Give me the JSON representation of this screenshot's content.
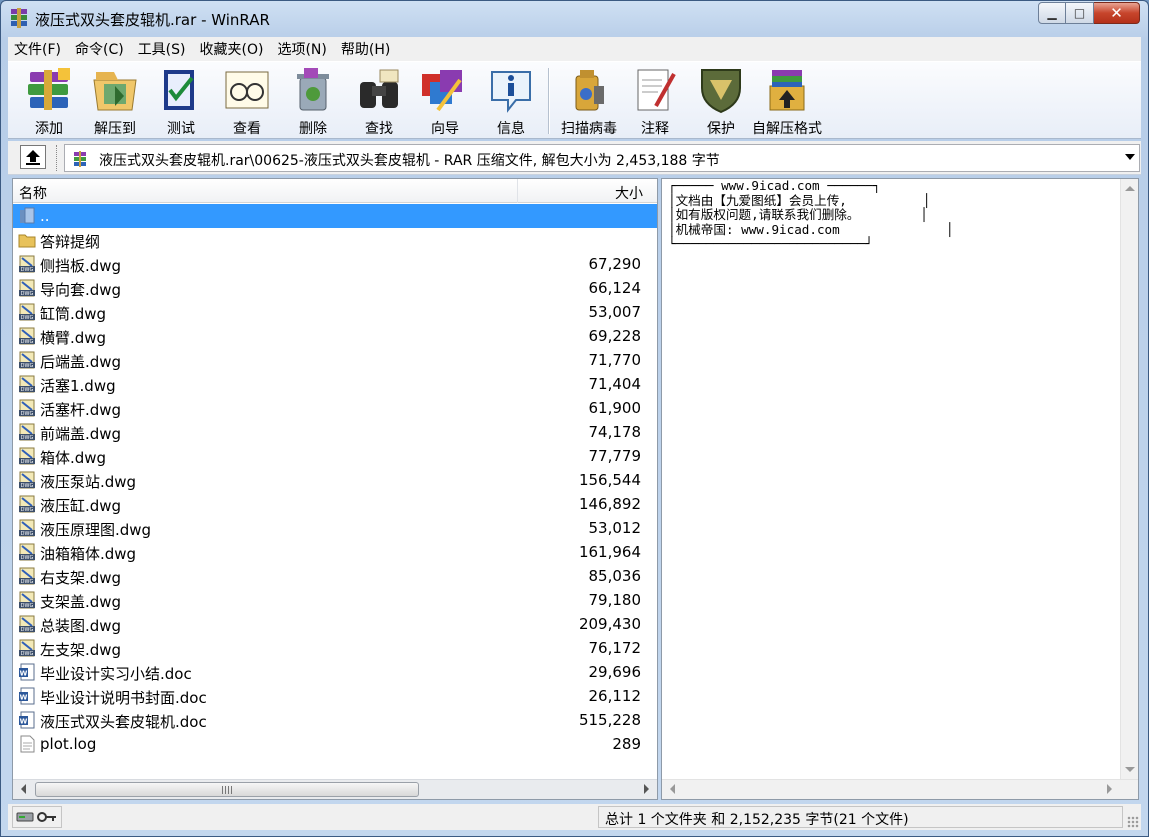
{
  "window": {
    "title": "液压式双头套皮辊机.rar - WinRAR",
    "controls": {
      "minimize": "▁",
      "maximize": "□",
      "close": "✕"
    }
  },
  "menu": [
    "文件(F)",
    "命令(C)",
    "工具(S)",
    "收藏夹(O)",
    "选项(N)",
    "帮助(H)"
  ],
  "toolbar": [
    {
      "label": "添加",
      "icon": "add-books-icon"
    },
    {
      "label": "解压到",
      "icon": "extract-to-icon"
    },
    {
      "label": "测试",
      "icon": "test-icon"
    },
    {
      "label": "查看",
      "icon": "view-icon"
    },
    {
      "label": "删除",
      "icon": "delete-icon"
    },
    {
      "label": "查找",
      "icon": "find-icon"
    },
    {
      "label": "向导",
      "icon": "wizard-icon"
    },
    {
      "label": "信息",
      "icon": "info-icon"
    },
    {
      "label": "扫描病毒",
      "icon": "virus-scan-icon"
    },
    {
      "label": "注释",
      "icon": "comment-icon"
    },
    {
      "label": "保护",
      "icon": "protect-icon"
    },
    {
      "label": "自解压格式",
      "icon": "sfx-icon"
    }
  ],
  "address": {
    "path": "液压式双头套皮辊机.rar\\00625-液压式双头套皮辊机 - RAR 压缩文件, 解包大小为 2,453,188 字节"
  },
  "filelist": {
    "columns": {
      "name": "名称",
      "size": "大小"
    },
    "rows": [
      {
        "name": "..",
        "size": "",
        "type": "up"
      },
      {
        "name": "答辩提纲",
        "size": "",
        "type": "folder"
      },
      {
        "name": "侧挡板.dwg",
        "size": "67,290",
        "type": "dwg"
      },
      {
        "name": "导向套.dwg",
        "size": "66,124",
        "type": "dwg"
      },
      {
        "name": "缸筒.dwg",
        "size": "53,007",
        "type": "dwg"
      },
      {
        "name": "横臂.dwg",
        "size": "69,228",
        "type": "dwg"
      },
      {
        "name": "后端盖.dwg",
        "size": "71,770",
        "type": "dwg"
      },
      {
        "name": "活塞1.dwg",
        "size": "71,404",
        "type": "dwg"
      },
      {
        "name": "活塞杆.dwg",
        "size": "61,900",
        "type": "dwg"
      },
      {
        "name": "前端盖.dwg",
        "size": "74,178",
        "type": "dwg"
      },
      {
        "name": "箱体.dwg",
        "size": "77,779",
        "type": "dwg"
      },
      {
        "name": "液压泵站.dwg",
        "size": "156,544",
        "type": "dwg"
      },
      {
        "name": "液压缸.dwg",
        "size": "146,892",
        "type": "dwg"
      },
      {
        "name": "液压原理图.dwg",
        "size": "53,012",
        "type": "dwg"
      },
      {
        "name": "油箱箱体.dwg",
        "size": "161,964",
        "type": "dwg"
      },
      {
        "name": "右支架.dwg",
        "size": "85,036",
        "type": "dwg"
      },
      {
        "name": "支架盖.dwg",
        "size": "79,180",
        "type": "dwg"
      },
      {
        "name": "总装图.dwg",
        "size": "209,430",
        "type": "dwg"
      },
      {
        "name": "左支架.dwg",
        "size": "76,172",
        "type": "dwg"
      },
      {
        "name": "毕业设计实习小结.doc",
        "size": "29,696",
        "type": "doc"
      },
      {
        "name": "毕业设计说明书封面.doc",
        "size": "26,112",
        "type": "doc"
      },
      {
        "name": "液压式双头套皮辊机.doc",
        "size": "515,228",
        "type": "doc"
      },
      {
        "name": "plot.log",
        "size": "289",
        "type": "txt"
      }
    ],
    "selected_index": 0
  },
  "comment": {
    "text": "┌───── www.9icad.com ──────┐\n│文档由【九爱图纸】会员上传,          │\n│如有版权问题,请联系我们删除。        │\n│机械帝国: www.9icad.com              │\n└─────────────────────────┘"
  },
  "status": {
    "summary": "总计 1 个文件夹 和 2,152,235 字节(21 个文件)"
  }
}
